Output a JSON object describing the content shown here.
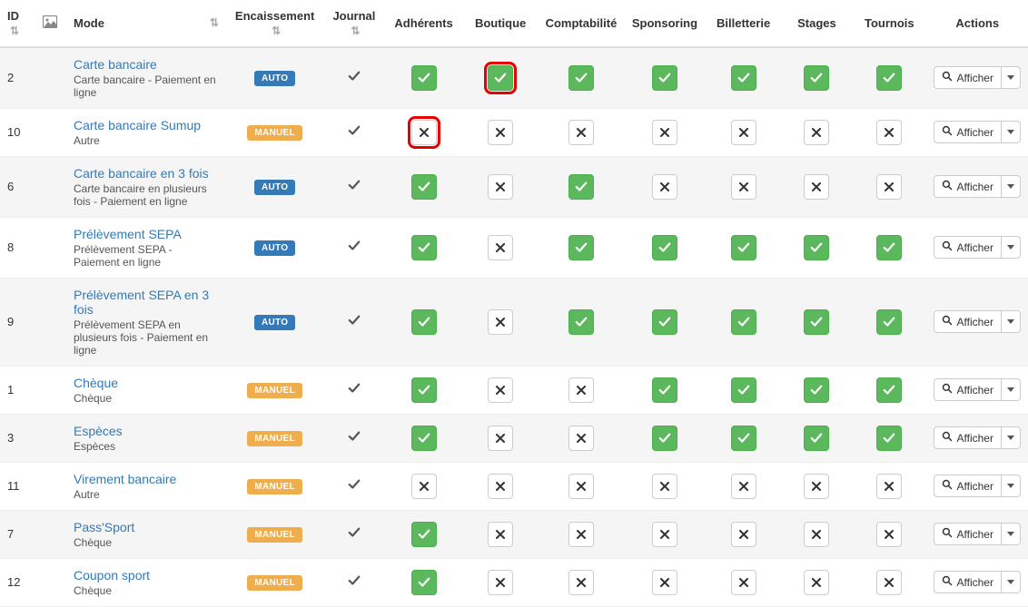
{
  "headers": {
    "id": "ID",
    "mode": "Mode",
    "encaissement": "Encaissement",
    "journal": "Journal",
    "adherents": "Adhérents",
    "boutique": "Boutique",
    "comptabilite": "Comptabilité",
    "sponsoring": "Sponsoring",
    "billetterie": "Billetterie",
    "stages": "Stages",
    "tournois": "Tournois",
    "actions": "Actions"
  },
  "badge_labels": {
    "auto": "AUTO",
    "manuel": "MANUEL"
  },
  "action_label": "Afficher",
  "rows": [
    {
      "id": "2",
      "name": "Carte bancaire",
      "sub": "Carte bancaire - Paiement en ligne",
      "enc": "auto",
      "journal": true,
      "cells": [
        "g",
        "g",
        "g",
        "g",
        "g",
        "g",
        "g"
      ],
      "hl": {
        "boutique": true
      }
    },
    {
      "id": "10",
      "name": "Carte bancaire Sumup",
      "sub": "Autre",
      "enc": "manuel",
      "journal": true,
      "cells": [
        "x",
        "x",
        "x",
        "x",
        "x",
        "x",
        "x"
      ],
      "hl": {
        "adherents": true
      }
    },
    {
      "id": "6",
      "name": "Carte bancaire en 3 fois",
      "sub": "Carte bancaire en plusieurs fois - Paiement en ligne",
      "enc": "auto",
      "journal": true,
      "cells": [
        "g",
        "x",
        "g",
        "x",
        "x",
        "x",
        "x"
      ],
      "hl": {}
    },
    {
      "id": "8",
      "name": "Prélèvement SEPA",
      "sub": "Prélèvement SEPA - Paiement en ligne",
      "enc": "auto",
      "journal": true,
      "cells": [
        "g",
        "x",
        "g",
        "g",
        "g",
        "g",
        "g"
      ],
      "hl": {}
    },
    {
      "id": "9",
      "name": "Prélèvement SEPA en 3 fois",
      "sub": "Prélèvement SEPA en plusieurs fois - Paiement en ligne",
      "enc": "auto",
      "journal": true,
      "cells": [
        "g",
        "x",
        "g",
        "g",
        "g",
        "g",
        "g"
      ],
      "hl": {}
    },
    {
      "id": "1",
      "name": "Chèque",
      "sub": "Chèque",
      "enc": "manuel",
      "journal": true,
      "cells": [
        "g",
        "x",
        "x",
        "g",
        "g",
        "g",
        "g"
      ],
      "hl": {}
    },
    {
      "id": "3",
      "name": "Espèces",
      "sub": "Espèces",
      "enc": "manuel",
      "journal": true,
      "cells": [
        "g",
        "x",
        "x",
        "g",
        "g",
        "g",
        "g"
      ],
      "hl": {}
    },
    {
      "id": "11",
      "name": "Virement bancaire",
      "sub": "Autre",
      "enc": "manuel",
      "journal": true,
      "cells": [
        "x",
        "x",
        "x",
        "x",
        "x",
        "x",
        "x"
      ],
      "hl": {}
    },
    {
      "id": "7",
      "name": "Pass'Sport",
      "sub": "Chèque",
      "enc": "manuel",
      "journal": true,
      "cells": [
        "g",
        "x",
        "x",
        "x",
        "x",
        "x",
        "x"
      ],
      "hl": {}
    },
    {
      "id": "12",
      "name": "Coupon sport",
      "sub": "Chèque",
      "enc": "manuel",
      "journal": true,
      "cells": [
        "g",
        "x",
        "x",
        "x",
        "x",
        "x",
        "x"
      ],
      "hl": {}
    }
  ]
}
